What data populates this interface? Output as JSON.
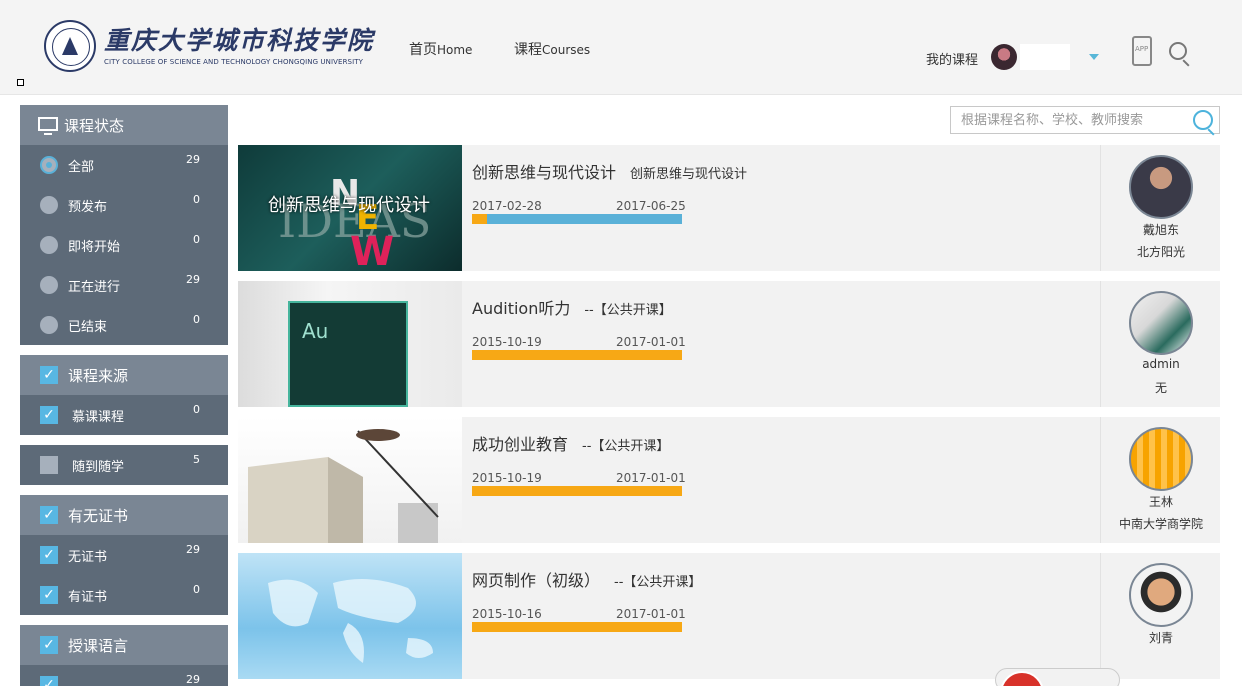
{
  "header": {
    "school_cn": "重庆大学城市科技学院",
    "school_en": "CITY COLLEGE OF SCIENCE AND TECHNOLOGY CHONGQING UNIVERSITY",
    "nav": [
      {
        "cn": "首页",
        "en": "Home"
      },
      {
        "cn": "课程",
        "en": "Courses"
      }
    ],
    "my_course": "我的课程",
    "app_label": "APP"
  },
  "search": {
    "placeholder": "根据课程名称、学校、教师搜索"
  },
  "sidebar": {
    "status": {
      "title": "课程状态",
      "items": [
        {
          "label": "全部",
          "count": "29",
          "selected": true
        },
        {
          "label": "预发布",
          "count": "0"
        },
        {
          "label": "即将开始",
          "count": "0"
        },
        {
          "label": "正在进行",
          "count": "29"
        },
        {
          "label": "已结束",
          "count": "0"
        }
      ]
    },
    "source": {
      "title": "课程来源",
      "items": [
        {
          "label": "慕课课程",
          "count": "0",
          "checked": true
        },
        {
          "label": "随到随学",
          "count": "5",
          "checked": false
        }
      ]
    },
    "certificate": {
      "title": "有无证书",
      "items": [
        {
          "label": "无证书",
          "count": "29",
          "checked": true
        },
        {
          "label": "有证书",
          "count": "0",
          "checked": true
        }
      ]
    },
    "language": {
      "title": "授课语言",
      "items": [
        {
          "label": "",
          "count": "29",
          "checked": true
        }
      ]
    }
  },
  "courses": [
    {
      "title": "创新思维与现代设计",
      "subtitle": "创新思维与现代设计",
      "thumb_text": "创新思维与现代设计",
      "start": "2017-02-28",
      "end": "2017-06-25",
      "progress": 0.07,
      "bar_color": "#5ab1d8",
      "teacher": "戴旭东",
      "org": "北方阳光"
    },
    {
      "title": "Audition听力",
      "subtitle": "--【公共开课】",
      "thumb_text": "Au",
      "start": "2015-10-19",
      "end": "2017-01-01",
      "progress": 1.0,
      "bar_color": "#f7a815",
      "teacher": "admin",
      "org": "无"
    },
    {
      "title": "成功创业教育",
      "subtitle": "--【公共开课】",
      "start": "2015-10-19",
      "end": "2017-01-01",
      "progress": 1.0,
      "bar_color": "#f7a815",
      "teacher": "王林",
      "org": "中南大学商学院"
    },
    {
      "title": "网页制作（初级）",
      "subtitle": "--【公共开课】",
      "start": "2015-10-16",
      "end": "2017-01-01",
      "progress": 1.0,
      "bar_color": "#f7a815",
      "teacher": "刘青",
      "org": ""
    }
  ]
}
